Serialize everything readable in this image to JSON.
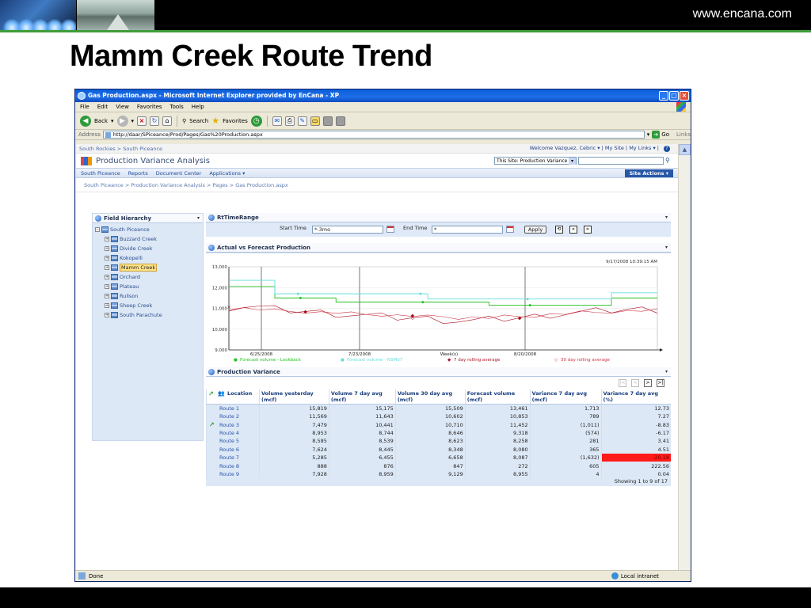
{
  "slide": {
    "url_text": "www.encana.com",
    "title": "Mamm Creek Route Trend"
  },
  "browser": {
    "title": "Gas Production.aspx - Microsoft Internet Explorer provided by EnCana - XP",
    "menu": [
      "File",
      "Edit",
      "View",
      "Favorites",
      "Tools",
      "Help"
    ],
    "toolbar": {
      "back": "Back",
      "search": "Search",
      "favorites": "Favorites"
    },
    "address_label": "Address",
    "address": "http://daar/SPiceance/Prod/Pages/Gas%20Production.aspx",
    "go": "Go",
    "links": "Links",
    "status": "Done",
    "zone": "Local intranet"
  },
  "sharepoint": {
    "top_crumb": "South Rockies > South Piceance",
    "welcome": "Welcome Vazquez, Cebric ▾  |  My Site  |  My Links ▾  |",
    "site_title": "Production Variance Analysis",
    "search_scope": "This Site: Production Variance",
    "nav": [
      "South Piceance",
      "Reports",
      "Document Center",
      "Applications ▾"
    ],
    "site_actions": "Site Actions ▾",
    "breadcrumb": "South Piceance > Production Variance Analysis > Pages > Gas Production.aspx"
  },
  "field_hierarchy": {
    "title": "Field Hierarchy",
    "root": "South Piceance",
    "children": [
      "Buzzard Creek",
      "Divide Creek",
      "Kokopelli",
      "Mamm Creek",
      "Orchard",
      "Plateau",
      "Rulison",
      "Sheep Creek",
      "South Parachute"
    ],
    "selected": "Mamm Creek"
  },
  "time_range": {
    "title": "RtTimeRange",
    "start_label": "Start Time",
    "start_value": "*-3mo",
    "end_label": "End Time",
    "end_value": "*",
    "apply": "Apply"
  },
  "chart_panel": {
    "title": "Actual vs Forecast Production"
  },
  "chart_data": {
    "type": "line",
    "timestamp": "9/17/2008 10:39:15 AM",
    "y_ticks": [
      "13,000",
      "12,000",
      "11,000",
      "10,000",
      "9,000"
    ],
    "ylim": [
      9000,
      13000
    ],
    "x_ticks": [
      "6/25/2008",
      "7/23/2008",
      "Week(s)",
      "8/20/2008"
    ],
    "series": [
      {
        "name": "Forecast volume - Lookback",
        "color": "#22c022",
        "values": [
          12050,
          12050,
          12050,
          11500,
          11500,
          11500,
          11500,
          11300,
          11300,
          11300,
          11300,
          11300,
          11300,
          11300,
          11300,
          11300,
          11300,
          11150,
          11150,
          11150,
          11150,
          11150,
          11150,
          11150,
          11150,
          11500,
          11500,
          11500,
          11500
        ]
      },
      {
        "name": "Forecast volume - NSM07",
        "color": "#66dddd",
        "values": [
          12350,
          12350,
          12350,
          11700,
          11700,
          11700,
          11700,
          11700,
          11700,
          11700,
          11700,
          11700,
          11700,
          11450,
          11450,
          11450,
          11450,
          11450,
          11450,
          11450,
          11450,
          11450,
          11450,
          11450,
          11450,
          11750,
          11750,
          11750,
          11750
        ]
      },
      {
        "name": "7 day rolling average",
        "color": "#aa1122",
        "values": [
          11050,
          11100,
          11050,
          10950,
          10900,
          10850,
          10800,
          10750,
          10700,
          10650,
          10600,
          10550,
          10550,
          10500,
          10450,
          10400,
          10400,
          10450,
          10500,
          10550,
          10600,
          10700,
          10750,
          10800,
          10850,
          10900,
          10950,
          10950,
          10950
        ]
      },
      {
        "name": "30 day rolling average",
        "color": "#cc3344",
        "values": [
          11000,
          11000,
          10950,
          10900,
          10850,
          10850,
          10800,
          10800,
          10750,
          10700,
          10700,
          10650,
          10650,
          10600,
          10600,
          10550,
          10550,
          10550,
          10600,
          10600,
          10650,
          10700,
          10750,
          10800,
          10800,
          10850,
          10850,
          10900,
          10900
        ]
      }
    ],
    "legend": [
      "Forecast volume - Lookback",
      "Forecast volume - NSM07",
      "7 day rolling average",
      "30 day rolling average"
    ]
  },
  "variance_panel": {
    "title": "Production Variance"
  },
  "table": {
    "columns": [
      "Location",
      "Volume yesterday (mcf)",
      "Volume 7 day avg (mcf)",
      "Volume 30 day avg (mcf)",
      "Forecast volume (mcf)",
      "Variance 7 day avg (mcf)",
      "Variance 7 day avg (%)"
    ],
    "rows": [
      [
        "Route 1",
        "15,819",
        "15,175",
        "15,509",
        "13,461",
        "1,713",
        "12.73"
      ],
      [
        "Route 2",
        "11,569",
        "11,643",
        "10,602",
        "10,853",
        "789",
        "7.27"
      ],
      [
        "Route 3",
        "7,479",
        "10,441",
        "10,710",
        "11,452",
        "(1,011)",
        "-8.83"
      ],
      [
        "Route 4",
        "8,953",
        "8,744",
        "8,646",
        "9,318",
        "(574)",
        "-6.17"
      ],
      [
        "Route 5",
        "8,585",
        "8,539",
        "8,623",
        "8,258",
        "281",
        "3.41"
      ],
      [
        "Route 6",
        "7,624",
        "8,445",
        "8,348",
        "8,080",
        "365",
        "4.51"
      ],
      [
        "Route 7",
        "5,285",
        "6,455",
        "6,658",
        "8,087",
        "(1,632)",
        "-20.18"
      ],
      [
        "Route 8",
        "888",
        "876",
        "847",
        "272",
        "605",
        "222.56"
      ],
      [
        "Route 9",
        "7,928",
        "8,959",
        "9,129",
        "8,955",
        "4",
        "0.04"
      ]
    ],
    "showing": "Showing 1 to 9 of 17"
  }
}
